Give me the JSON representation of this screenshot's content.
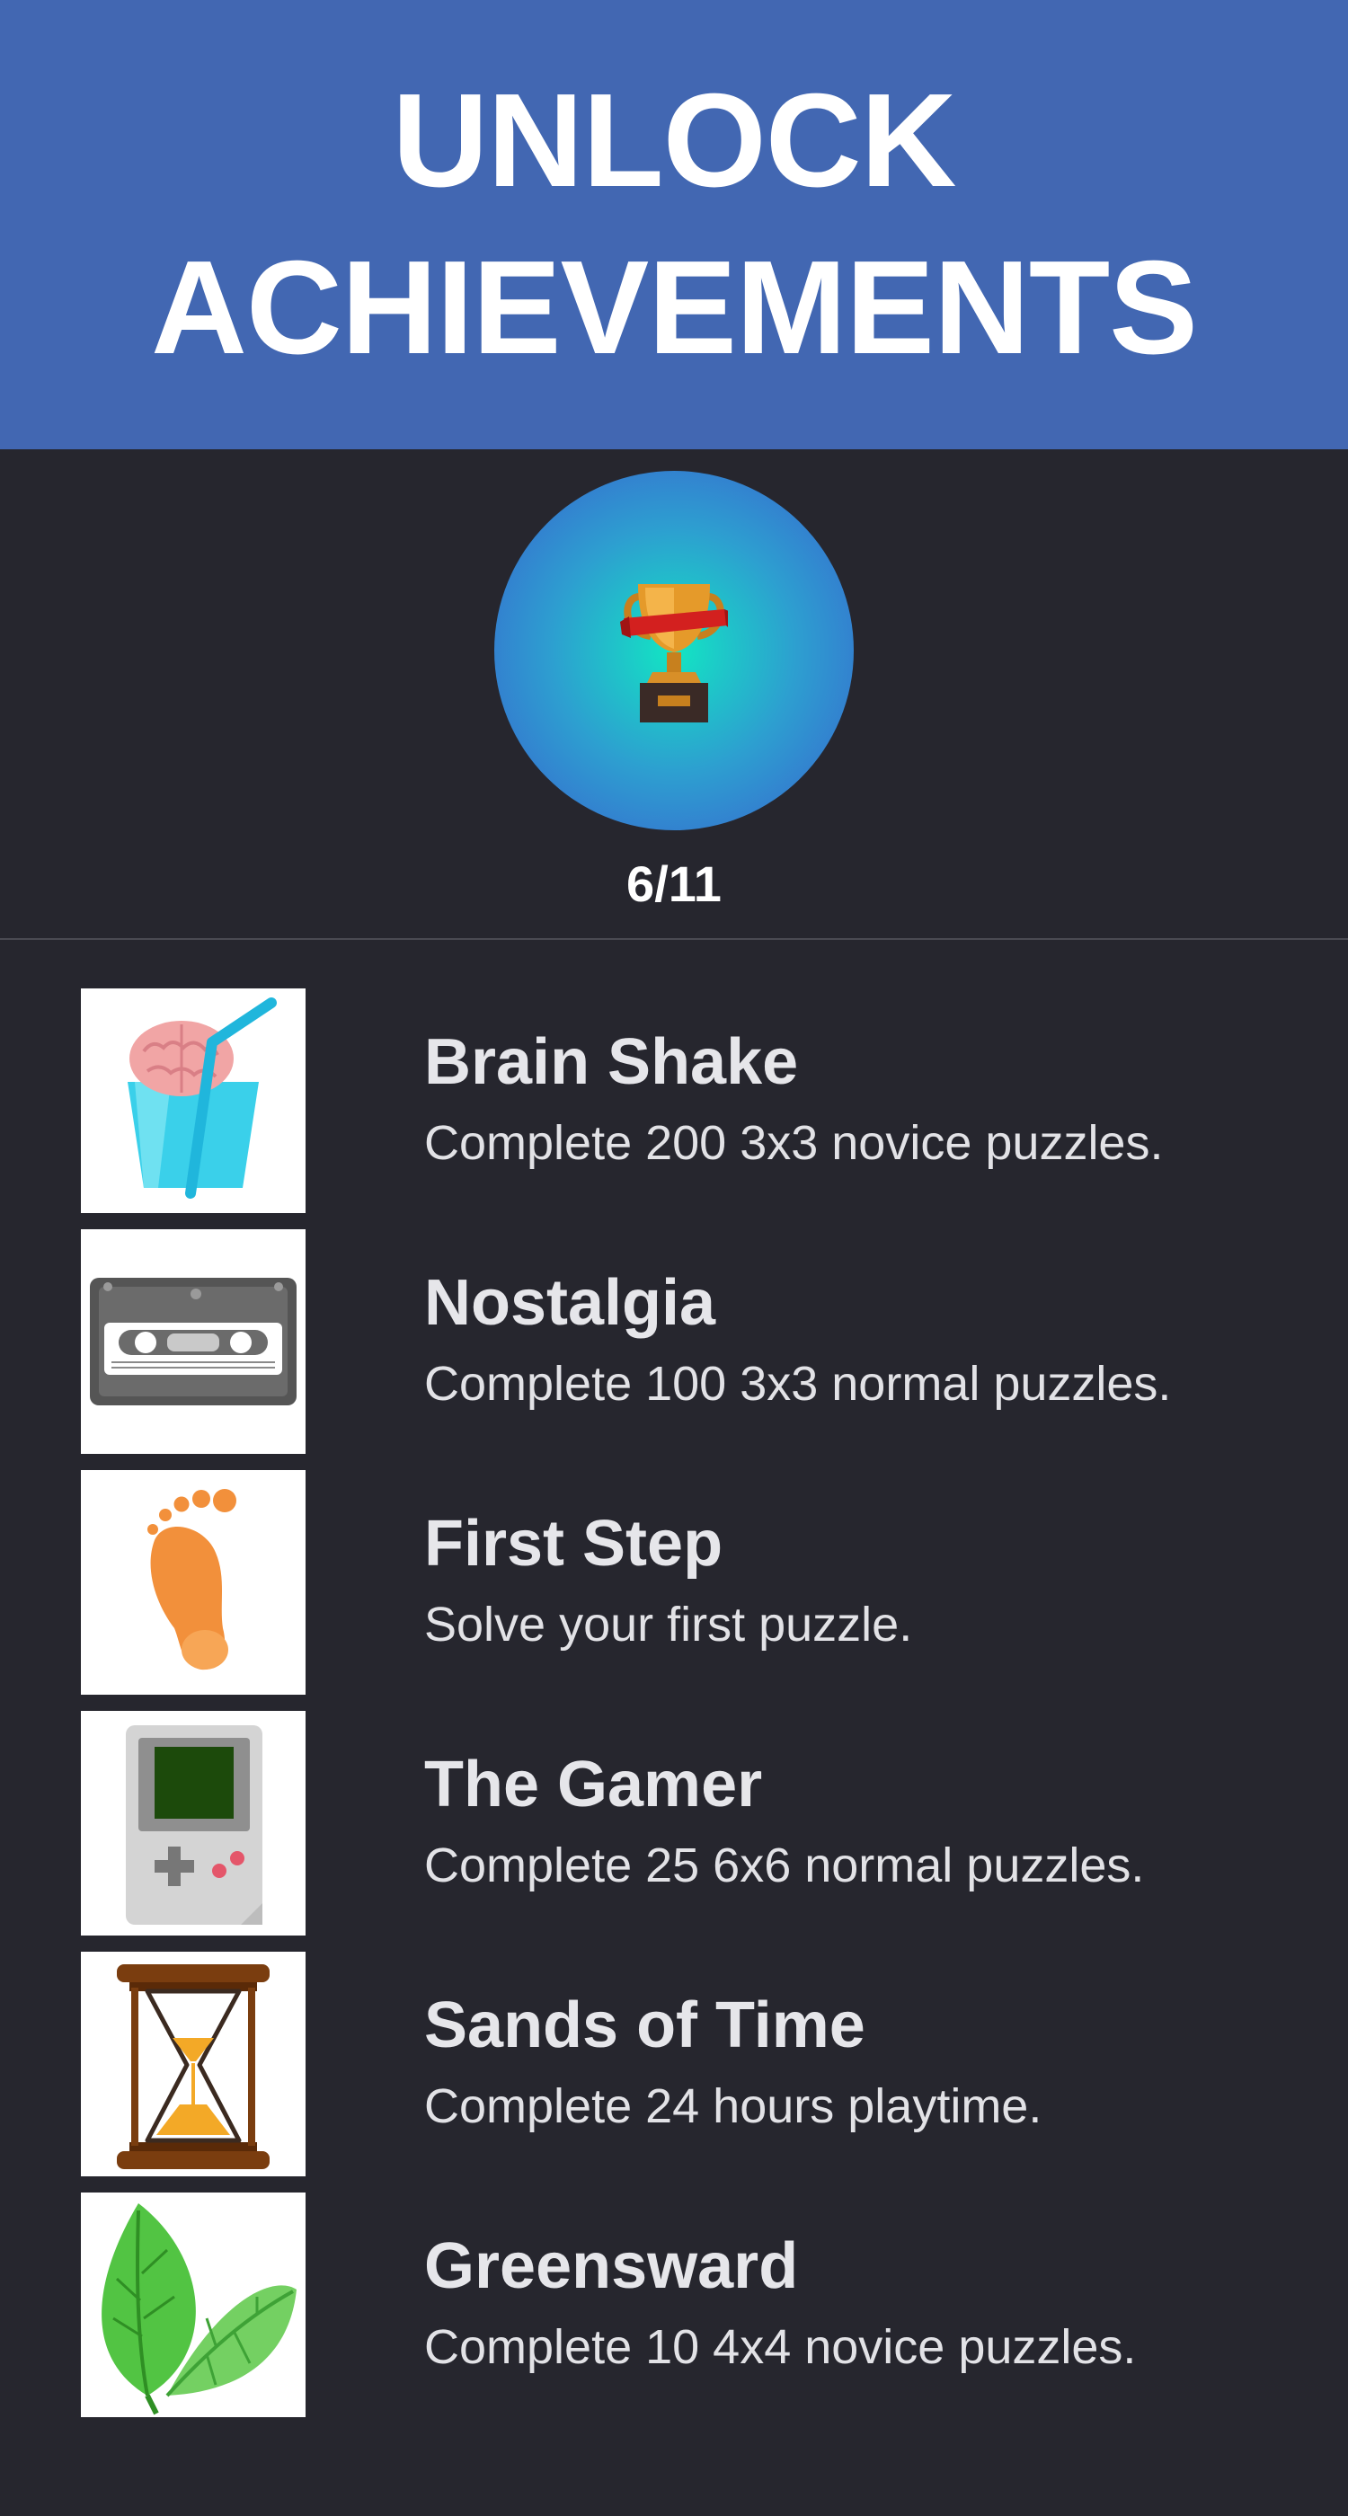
{
  "banner": {
    "line1": "UNLOCK",
    "line2": "ACHIEVEMENTS",
    "color": "#4267b2"
  },
  "summary": {
    "icon": "trophy-icon",
    "count": "6/11",
    "unlocked": 6,
    "total": 11
  },
  "achievements": [
    {
      "title": "Brain Shake",
      "description": "Complete 200 3x3 novice puzzles.",
      "icon": "brain-shake-icon"
    },
    {
      "title": "Nostalgia",
      "description": "Complete 100 3x3 normal puzzles.",
      "icon": "cassette-tape-icon"
    },
    {
      "title": "First Step",
      "description": "Solve your first puzzle.",
      "icon": "footprint-icon"
    },
    {
      "title": "The Gamer",
      "description": "Complete 25 6x6 normal puzzles.",
      "icon": "handheld-console-icon"
    },
    {
      "title": "Sands of Time",
      "description": "Complete 24 hours playtime.",
      "icon": "hourglass-icon"
    },
    {
      "title": "Greensward",
      "description": "Complete 10 4x4 novice puzzles.",
      "icon": "leaves-icon"
    }
  ],
  "colors": {
    "background": "#26262e",
    "text": "#e6e6ea"
  }
}
